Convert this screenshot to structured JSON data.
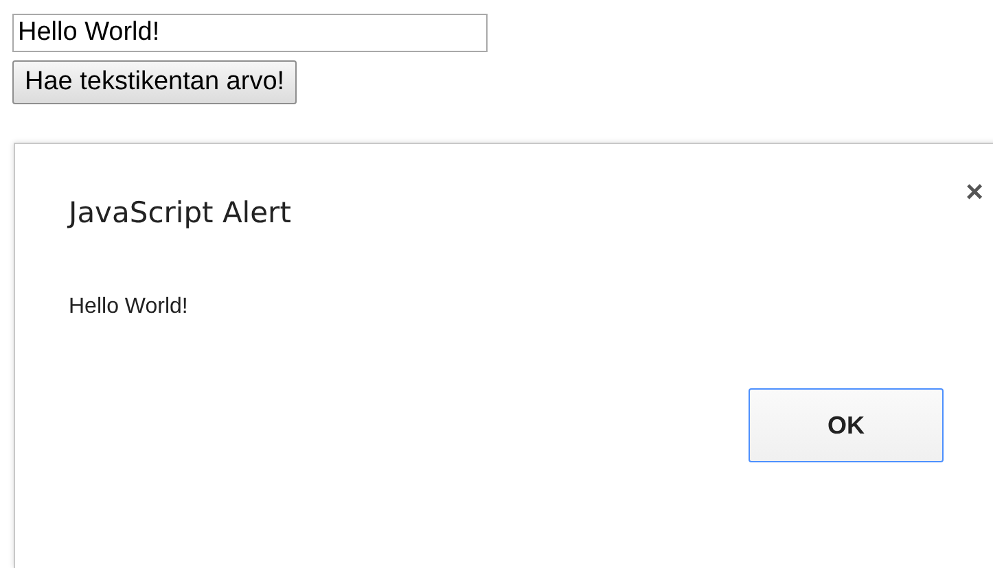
{
  "text_field": {
    "value": "Hello World!"
  },
  "get_button": {
    "label": "Hae tekstikentan arvo!"
  },
  "alert": {
    "title": "JavaScript Alert",
    "close": "×",
    "message": "Hello World!",
    "ok_button": "OK"
  }
}
